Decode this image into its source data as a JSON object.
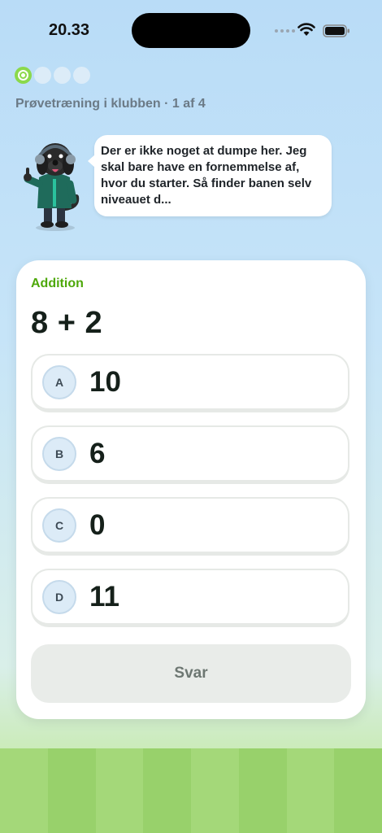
{
  "status_bar": {
    "time": "20.33",
    "icons": [
      "signal-dots-icon",
      "wifi-icon",
      "battery-icon"
    ]
  },
  "progress": {
    "current": 1,
    "total": 4,
    "active_color": "#8bd94b"
  },
  "subtitle": "Prøvetræning i klubben · 1 af 4",
  "mascot": {
    "icon": "dog-mascot-icon",
    "speech": "Der er ikke noget at dumpe her. Jeg skal bare have en fornemmelse af, hvor du starter. Så finder banen selv niveauet d..."
  },
  "quiz": {
    "category": "Addition",
    "question": "8 + 2",
    "options": [
      {
        "letter": "A",
        "value": "10"
      },
      {
        "letter": "B",
        "value": "6"
      },
      {
        "letter": "C",
        "value": "0"
      },
      {
        "letter": "D",
        "value": "11"
      }
    ],
    "submit_label": "Svar"
  },
  "colors": {
    "category": "#4ea80a",
    "text_dark": "#15201a",
    "letter_badge": "#dcebf7",
    "button_disabled": "#e9ece9"
  }
}
